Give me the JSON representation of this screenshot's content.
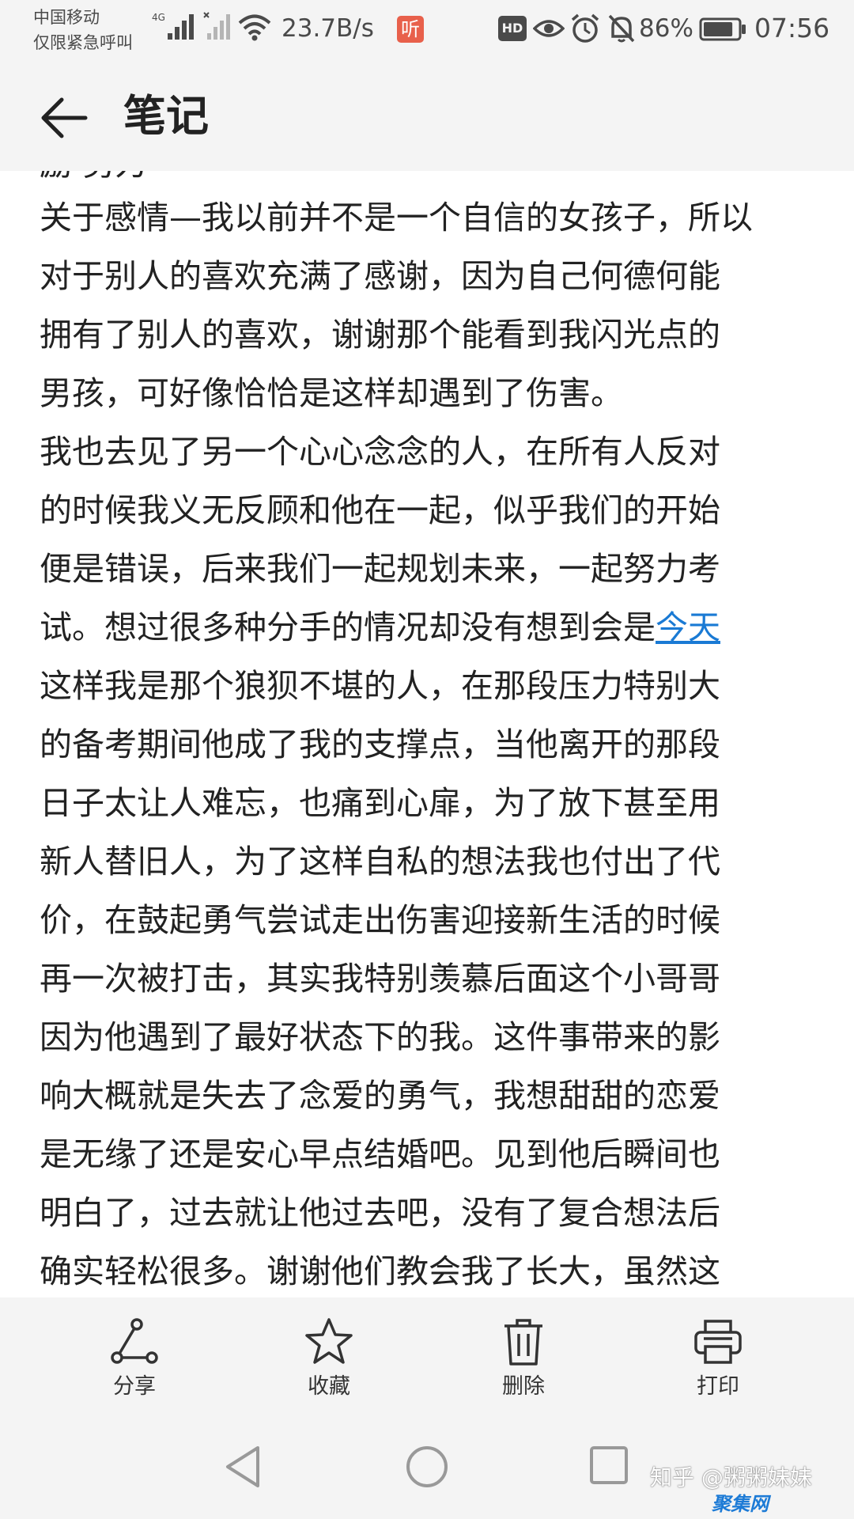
{
  "status_bar": {
    "carrier_line1": "中国移动",
    "carrier_line2": "仅限紧急呼叫",
    "network_label": "4G",
    "net_speed": "23.7B/s",
    "listen_badge": "听",
    "hd_badge": "HD",
    "battery_percent": "86%",
    "battery_level": 0.86,
    "time": "07:56"
  },
  "header": {
    "back_icon": "arrow-left-icon",
    "title": "笔记"
  },
  "note": {
    "clipped_top_line": "励·努力",
    "lines": [
      "关于感情—我以前并不是一个自信的女孩子，所以",
      "对于别人的喜欢充满了感谢，因为自己何德何能",
      "拥有了别人的喜欢，谢谢那个能看到我闪光点的",
      "男孩，可好像恰恰是这样却遇到了伤害。",
      "我也去见了另一个心心念念的人，在所有人反对",
      "的时候我义无反顾和他在一起，似乎我们的开始",
      "便是错误，后来我们一起规划未来，一起努力考"
    ],
    "link_line_prefix": "试。想过很多种分手的情况却没有想到会是",
    "link_text": "今天",
    "lines_after": [
      "这样我是那个狼狈不堪的人，在那段压力特别大",
      "的备考期间他成了我的支撑点，当他离开的那段",
      "日子太让人难忘，也痛到心扉，为了放下甚至用",
      "新人替旧人，为了这样自私的想法我也付出了代",
      "价，在鼓起勇气尝试走出伤害迎接新生活的时候",
      "再一次被打击，其实我特别羡慕后面这个小哥哥",
      "因为他遇到了最好状态下的我。这件事带来的影",
      "响大概就是失去了念爱的勇气，我想甜甜的恋爱",
      "是无缘了还是安心早点结婚吧。见到他后瞬间也",
      "明白了，过去就让他过去吧，没有了复合想法后",
      "确实轻松很多。谢谢他们教会我了长大，虽然这"
    ]
  },
  "toolbar": {
    "items": [
      {
        "label": "分享",
        "icon": "share-icon"
      },
      {
        "label": "收藏",
        "icon": "star-icon"
      },
      {
        "label": "删除",
        "icon": "trash-icon"
      },
      {
        "label": "打印",
        "icon": "printer-icon"
      }
    ]
  },
  "nav_bar": {
    "back_icon": "triangle-back-icon",
    "home_icon": "circle-home-icon",
    "recents_icon": "square-recents-icon"
  },
  "watermark": {
    "text": "知乎 @粥粥妹妹",
    "logo_text": "聚集网"
  },
  "colors": {
    "link": "#1a7ad4",
    "background_bar": "#f4f4f4",
    "note_background": "#ffffff",
    "listen_badge": "#e8604b"
  }
}
